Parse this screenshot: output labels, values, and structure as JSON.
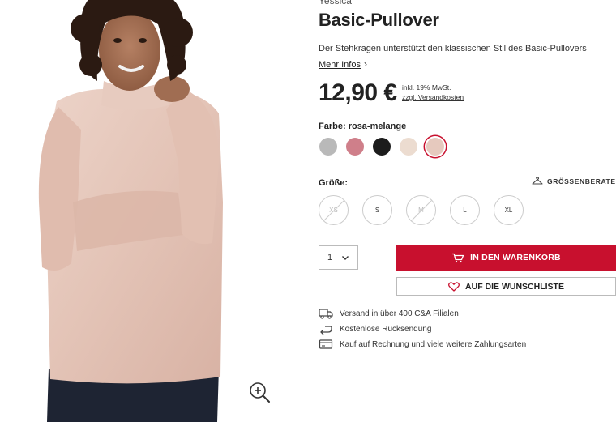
{
  "product": {
    "brand": "Yessica",
    "title": "Basic-Pullover",
    "description": "Der Stehkragen unterstützt den klassischen Stil des Basic-Pullovers",
    "more_info": "Mehr Infos",
    "price": "12,90 €",
    "tax_note": "inkl. 19% MwSt.",
    "shipping_link": "zzgl. Versandkosten"
  },
  "color": {
    "label": "Farbe:",
    "selected": "rosa-melange",
    "swatches": [
      {
        "name": "grau-melange",
        "hex": "#b9b9b9"
      },
      {
        "name": "rosa-dunkel",
        "hex": "#cf7f8a"
      },
      {
        "name": "schwarz",
        "hex": "#1c1c1c"
      },
      {
        "name": "beige",
        "hex": "#ecdcd0"
      },
      {
        "name": "rosa-melange",
        "hex": "#e6c9be"
      }
    ]
  },
  "size": {
    "label": "Größe:",
    "advisor": "GRÖSSENBERATER",
    "options": [
      {
        "label": "XS",
        "available": false
      },
      {
        "label": "S",
        "available": true
      },
      {
        "label": "M",
        "available": false
      },
      {
        "label": "L",
        "available": true
      },
      {
        "label": "XL",
        "available": true
      }
    ]
  },
  "purchase": {
    "quantity": "1",
    "add_to_cart": "IN DEN WARENKORB",
    "wishlist": "AUF DIE WUNSCHLISTE"
  },
  "usps": [
    {
      "icon": "truck-icon",
      "text": "Versand in über 400 C&A Filialen"
    },
    {
      "icon": "return-arrow-icon",
      "text": "Kostenlose Rücksendung"
    },
    {
      "icon": "payment-card-icon",
      "text": "Kauf auf Rechnung und viele weitere Zahlungsarten"
    }
  ],
  "colors": {
    "accent": "#c8102e",
    "text": "#222222",
    "border": "#bbbbbb"
  }
}
